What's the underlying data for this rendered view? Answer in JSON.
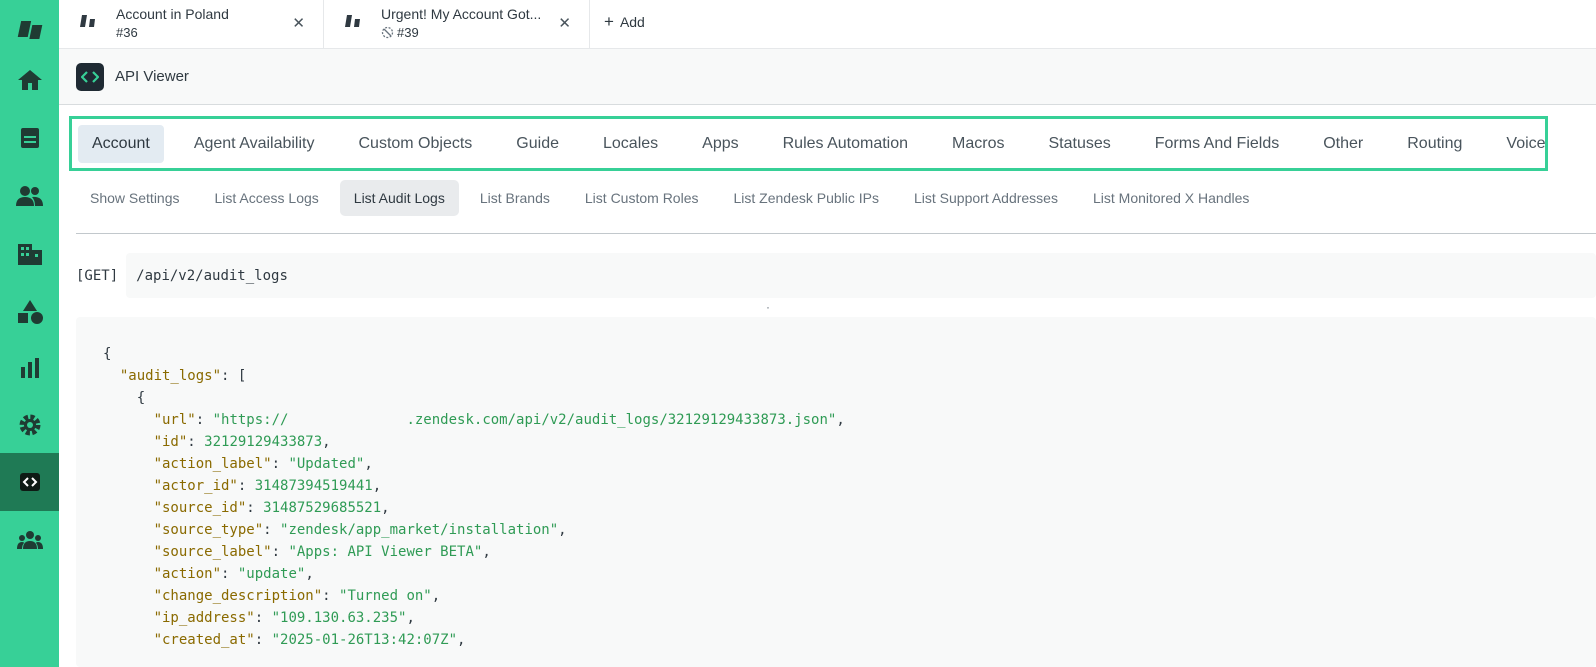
{
  "tabs": [
    {
      "title": "Account in Poland",
      "subtitle": "#36"
    },
    {
      "title": "Urgent! My Account Got...",
      "subtitle": "#39"
    }
  ],
  "add_tab_label": "Add",
  "app": {
    "title": "API Viewer"
  },
  "category_tabs": [
    "Account",
    "Agent Availability",
    "Custom Objects",
    "Guide",
    "Locales",
    "Apps",
    "Rules Automation",
    "Macros",
    "Statuses",
    "Forms And Fields",
    "Other",
    "Routing",
    "Voice"
  ],
  "active_category": "Account",
  "sub_tabs": [
    "Show Settings",
    "List Access Logs",
    "List Audit Logs",
    "List Brands",
    "List Custom Roles",
    "List Zendesk Public IPs",
    "List Support Addresses",
    "List Monitored X Handles"
  ],
  "active_sub_tab": "List Audit Logs",
  "endpoint": {
    "method": "[GET]",
    "path": "/api/v2/audit_logs"
  },
  "json": {
    "root_key": "audit_logs",
    "fields": [
      {
        "key": "url",
        "value": "https://              .zendesk.com/api/v2/audit_logs/32129129433873.json",
        "type": "string"
      },
      {
        "key": "id",
        "value": "32129129433873",
        "type": "number"
      },
      {
        "key": "action_label",
        "value": "Updated",
        "type": "string"
      },
      {
        "key": "actor_id",
        "value": "31487394519441",
        "type": "number"
      },
      {
        "key": "source_id",
        "value": "31487529685521",
        "type": "number"
      },
      {
        "key": "source_type",
        "value": "zendesk/app_market/installation",
        "type": "string"
      },
      {
        "key": "source_label",
        "value": "Apps: API Viewer BETA",
        "type": "string"
      },
      {
        "key": "action",
        "value": "update",
        "type": "string"
      },
      {
        "key": "change_description",
        "value": "Turned on",
        "type": "string"
      },
      {
        "key": "ip_address",
        "value": "109.130.63.235",
        "type": "string"
      },
      {
        "key": "created_at",
        "value": "2025-01-26T13:42:07Z",
        "type": "string"
      }
    ]
  },
  "colors": {
    "sidebar": "#37d097",
    "sidebar_active": "#1f7a55",
    "highlight_border": "#37d097",
    "json_key": "#8a6a00",
    "json_value": "#2f9b55"
  },
  "sidebar_icons": [
    "zendesk-logo-icon",
    "home-icon",
    "views-icon",
    "customers-icon",
    "organizations-icon",
    "objects-icon",
    "reporting-icon",
    "admin-settings-icon",
    "api-viewer-app-icon",
    "team-icon"
  ]
}
